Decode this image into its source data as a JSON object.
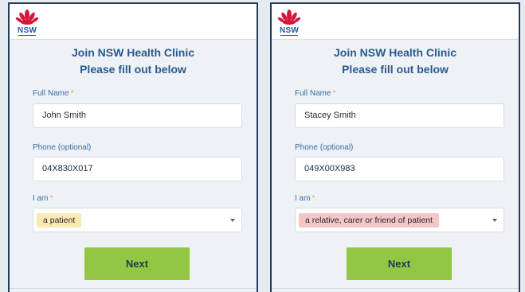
{
  "panels": [
    {
      "logo_text": "NSW",
      "title_line1": "Join NSW Health Clinic",
      "title_line2": "Please fill out below",
      "name_label": "Full Name",
      "name_required": "*",
      "name_value": "John Smith",
      "phone_label": "Phone (optional)",
      "phone_value": "04X830X017",
      "role_label": "I am",
      "role_required": "*",
      "role_value": "a patient",
      "role_highlight": "#fbe9b4",
      "next_label": "Next"
    },
    {
      "logo_text": "NSW",
      "title_line1": "Join NSW Health Clinic",
      "title_line2": "Please fill out below",
      "name_label": "Full Name",
      "name_required": "*",
      "name_value": "Stacey Smith",
      "phone_label": "Phone (optional)",
      "phone_value": "049X00X983",
      "role_label": "I am",
      "role_required": "*",
      "role_value": "a relative, carer or friend of patient",
      "role_highlight": "#f5c6c6",
      "next_label": "Next"
    }
  ],
  "colors": {
    "accent_button": "#93c743",
    "title": "#2b5a8c",
    "label": "#3a6ea5",
    "required": "#e9a23b",
    "border": "#1f3d5a"
  },
  "icons": {
    "logo": "nsw-waratah-logo",
    "dropdown": "chevron-down-icon"
  }
}
